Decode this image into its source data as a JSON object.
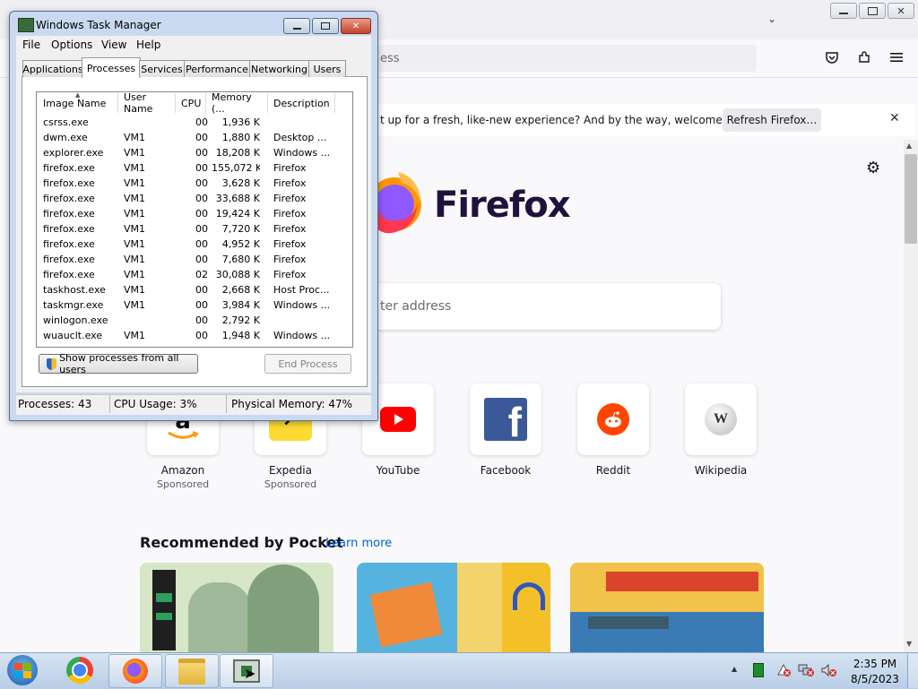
{
  "firefox": {
    "url_placeholder": "ess",
    "notification_text": "t up for a fresh, like-new experience? And by the way, welcome back!",
    "refresh_button": "Refresh Firefox…",
    "wordmark": "Firefox",
    "search_placeholder": "ter address",
    "shortcuts": [
      {
        "label": "Amazon",
        "sub": "Sponsored",
        "icon": "amazon-icon"
      },
      {
        "label": "Expedia",
        "sub": "Sponsored",
        "icon": "expedia-icon"
      },
      {
        "label": "YouTube",
        "sub": "",
        "icon": "youtube-icon"
      },
      {
        "label": "Facebook",
        "sub": "",
        "icon": "facebook-icon"
      },
      {
        "label": "Reddit",
        "sub": "",
        "icon": "reddit-icon"
      },
      {
        "label": "Wikipedia",
        "sub": "",
        "icon": "wikipedia-icon"
      }
    ],
    "pocket_title": "Recommended by Pocket",
    "pocket_link": "Learn more"
  },
  "taskmgr": {
    "title": "Windows Task Manager",
    "menu": [
      "File",
      "Options",
      "View",
      "Help"
    ],
    "tabs": [
      "Applications",
      "Processes",
      "Services",
      "Performance",
      "Networking",
      "Users"
    ],
    "active_tab": "Processes",
    "columns": [
      "Image Name",
      "User Name",
      "CPU",
      "Memory (...",
      "Description"
    ],
    "rows": [
      [
        "csrss.exe",
        "",
        "00",
        "1,936 K",
        ""
      ],
      [
        "dwm.exe",
        "VM1",
        "00",
        "1,880 K",
        "Desktop ..."
      ],
      [
        "explorer.exe",
        "VM1",
        "00",
        "18,208 K",
        "Windows ..."
      ],
      [
        "firefox.exe",
        "VM1",
        "00",
        "155,072 K",
        "Firefox"
      ],
      [
        "firefox.exe",
        "VM1",
        "00",
        "3,628 K",
        "Firefox"
      ],
      [
        "firefox.exe",
        "VM1",
        "00",
        "33,688 K",
        "Firefox"
      ],
      [
        "firefox.exe",
        "VM1",
        "00",
        "19,424 K",
        "Firefox"
      ],
      [
        "firefox.exe",
        "VM1",
        "00",
        "7,720 K",
        "Firefox"
      ],
      [
        "firefox.exe",
        "VM1",
        "00",
        "4,952 K",
        "Firefox"
      ],
      [
        "firefox.exe",
        "VM1",
        "00",
        "7,680 K",
        "Firefox"
      ],
      [
        "firefox.exe",
        "VM1",
        "02",
        "30,088 K",
        "Firefox"
      ],
      [
        "taskhost.exe",
        "VM1",
        "00",
        "2,668 K",
        "Host Proc..."
      ],
      [
        "taskmgr.exe",
        "VM1",
        "00",
        "3,984 K",
        "Windows ..."
      ],
      [
        "winlogon.exe",
        "",
        "00",
        "2,792 K",
        ""
      ],
      [
        "wuauclt.exe",
        "VM1",
        "00",
        "1,948 K",
        "Windows ..."
      ]
    ],
    "show_all_button": "Show processes from all users",
    "end_process_button": "End Process",
    "status": {
      "processes": "Processes: 43",
      "cpu": "CPU Usage: 3%",
      "memory": "Physical Memory: 47%"
    }
  },
  "taskbar": {
    "time": "2:35 PM",
    "date": "8/5/2023"
  }
}
